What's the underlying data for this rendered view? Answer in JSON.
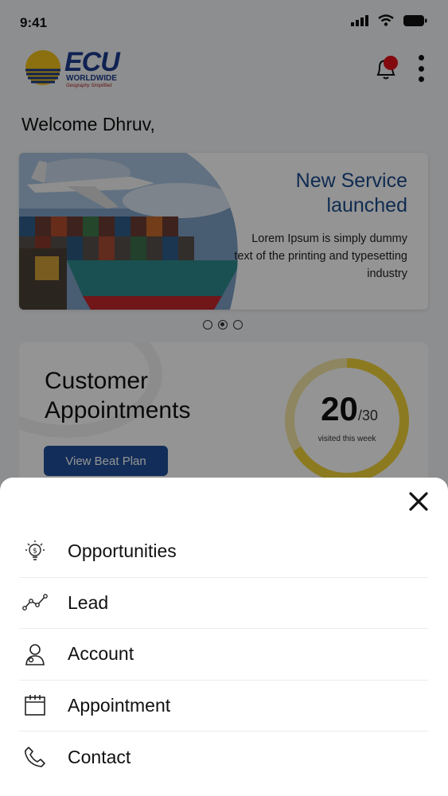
{
  "status_bar": {
    "time": "9:41"
  },
  "header": {
    "logo": {
      "main": "ECU",
      "sub": "WORLDWIDE",
      "tagline": "Geography Simplified"
    }
  },
  "welcome": "Welcome Dhruv,",
  "banner": {
    "title_line1": "New Service",
    "title_line2": "launched",
    "description": "Lorem Ipsum is simply dummy text of the printing and typesetting industry"
  },
  "carousel": {
    "slides": 3,
    "active_index": 1
  },
  "appointments": {
    "title_line1": "Customer",
    "title_line2": "Appointments",
    "button_label": "View Beat Plan",
    "visited": "20",
    "total": "/30",
    "caption": "visited this week",
    "progress_fraction": 0.667
  },
  "menu": {
    "items": [
      {
        "label": "Opportunities",
        "icon": "lightbulb-dollar-icon"
      },
      {
        "label": "Lead",
        "icon": "trend-line-icon"
      },
      {
        "label": "Account",
        "icon": "user-account-icon"
      },
      {
        "label": "Appointment",
        "icon": "calendar-icon"
      },
      {
        "label": "Contact",
        "icon": "phone-icon"
      }
    ]
  },
  "colors": {
    "brand_blue": "#1f4e99",
    "gauge_yellow": "#f1d23a",
    "notification_red": "#e0121b"
  }
}
